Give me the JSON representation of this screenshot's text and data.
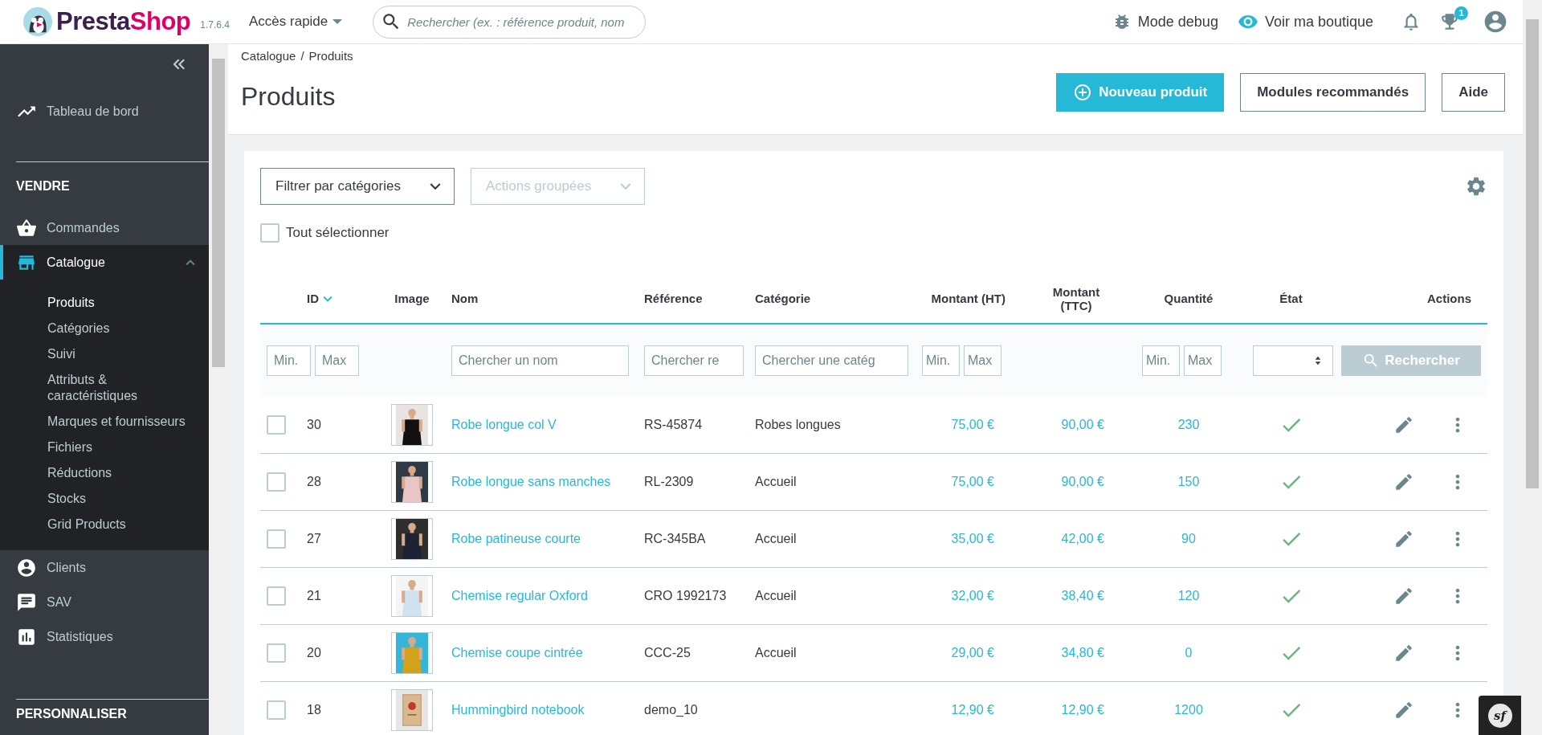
{
  "topbar": {
    "logo": {
      "first": "Presta",
      "second": "Shop"
    },
    "version": "1.7.6.4",
    "quick_access": "Accès rapide",
    "search": {
      "placeholder": "Rechercher (ex. : référence produit, nom"
    },
    "links": [
      {
        "kind": "debug",
        "label": "Mode debug"
      },
      {
        "kind": "shop",
        "label": "Voir ma boutique"
      }
    ],
    "notifications_badge": "1"
  },
  "sidebar": {
    "groups": [
      {
        "items": [
          {
            "kind": "dashboard",
            "label": "Tableau de bord",
            "selected": false
          }
        ]
      },
      {
        "heading": "VENDRE",
        "items": [
          {
            "kind": "orders",
            "label": "Commandes",
            "selected": false
          },
          {
            "kind": "catalog",
            "label": "Catalogue",
            "selected": true,
            "expanded": true,
            "children": [
              {
                "label": "Produits",
                "selected": true
              },
              {
                "label": "Catégories",
                "selected": false
              },
              {
                "label": "Suivi",
                "selected": false
              },
              {
                "label": "Attributs & caractéristiques",
                "selected": false
              },
              {
                "label": "Marques et fournisseurs",
                "selected": false
              },
              {
                "label": "Fichiers",
                "selected": false
              },
              {
                "label": "Réductions",
                "selected": false
              },
              {
                "label": "Stocks",
                "selected": false
              },
              {
                "label": "Grid Products",
                "selected": false
              }
            ]
          },
          {
            "kind": "customers",
            "label": "Clients",
            "selected": false
          },
          {
            "kind": "support",
            "label": "SAV",
            "selected": false
          },
          {
            "kind": "stats",
            "label": "Statistiques",
            "selected": false
          }
        ]
      },
      {
        "heading": "PERSONNALISER"
      }
    ]
  },
  "page": {
    "breadcrumb": [
      "Catalogue",
      "Produits"
    ],
    "breadcrumb_separator": "/",
    "title": "Produits",
    "buttons": [
      {
        "kind": "primary",
        "label": "Nouveau produit"
      },
      {
        "kind": "outline",
        "label": "Modules recommandés"
      },
      {
        "kind": "outline",
        "label": "Aide"
      }
    ]
  },
  "card": {
    "dropdowns": [
      {
        "label": "Filtrer par catégories",
        "disabled": false
      },
      {
        "label": "Actions groupées",
        "disabled": true
      }
    ],
    "select_all": {
      "label": "Tout sélectionner",
      "checked": false
    },
    "columns": [
      {
        "label": "ID",
        "sorted": true
      },
      {
        "label": "Image",
        "sorted": false
      },
      {
        "label": "Nom",
        "sorted": false
      },
      {
        "label": "Référence",
        "sorted": false
      },
      {
        "label": "Catégorie",
        "sorted": false
      },
      {
        "label": "Montant (HT)",
        "sorted": false
      },
      {
        "label": "Montant (TTC)",
        "sorted": false
      },
      {
        "label": "Quantité",
        "sorted": false
      },
      {
        "label": "État",
        "sorted": false
      },
      {
        "label": "Actions",
        "sorted": false
      }
    ],
    "filters": [
      {
        "kind": "range",
        "min_placeholder": "Min.",
        "max_placeholder": "Max"
      },
      {
        "kind": "none"
      },
      {
        "kind": "text",
        "placeholder": "Chercher un nom"
      },
      {
        "kind": "text",
        "placeholder": "Chercher re"
      },
      {
        "kind": "text",
        "placeholder": "Chercher une catég"
      },
      {
        "kind": "range",
        "min_placeholder": "Min.",
        "max_placeholder": "Max"
      },
      {
        "kind": "none"
      },
      {
        "kind": "range",
        "min_placeholder": "Min.",
        "max_placeholder": "Max"
      },
      {
        "kind": "select"
      },
      {
        "kind": "button",
        "label": "Rechercher",
        "disabled": true
      }
    ],
    "rows": [
      {
        "checked": false,
        "id": "30",
        "name": "Robe longue col V",
        "reference": "RS-45874",
        "category": "Robes longues",
        "price_ht": "75,00 €",
        "price_ttc": "90,00 €",
        "quantity": "230",
        "active": true
      },
      {
        "checked": false,
        "id": "28",
        "name": "Robe longue sans manches",
        "reference": "RL-2309",
        "category": "Accueil",
        "price_ht": "75,00 €",
        "price_ttc": "90,00 €",
        "quantity": "150",
        "active": true
      },
      {
        "checked": false,
        "id": "27",
        "name": "Robe patineuse courte",
        "reference": "RC-345BA",
        "category": "Accueil",
        "price_ht": "35,00 €",
        "price_ttc": "42,00 €",
        "quantity": "90",
        "active": true
      },
      {
        "checked": false,
        "id": "21",
        "name": "Chemise regular Oxford",
        "reference": "CRO 1992173",
        "category": "Accueil",
        "price_ht": "32,00 €",
        "price_ttc": "38,40 €",
        "quantity": "120",
        "active": true
      },
      {
        "checked": false,
        "id": "20",
        "name": "Chemise coupe cintrée",
        "reference": "CCC-25",
        "category": "Accueil",
        "price_ht": "29,00 €",
        "price_ttc": "34,80 €",
        "quantity": "0",
        "active": true
      },
      {
        "checked": false,
        "id": "18",
        "name": "Hummingbird notebook",
        "reference": "demo_10",
        "price_ht": "12,90 €",
        "price_ttc": "12,90 €",
        "quantity": "1200",
        "active": true
      }
    ]
  },
  "debug_toolbar": {
    "label": "sf"
  }
}
